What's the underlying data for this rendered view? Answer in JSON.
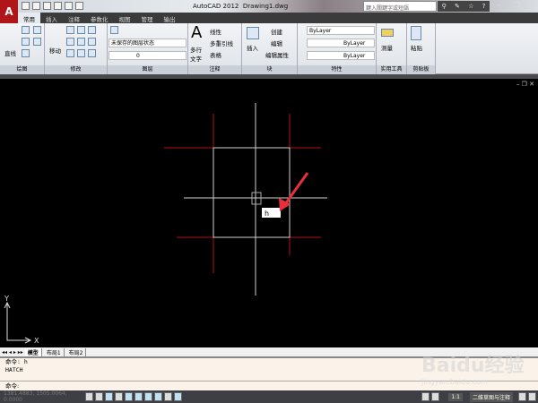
{
  "app": {
    "title": "AutoCAD 2012",
    "document": "Drawing1.dwg",
    "logo": "A",
    "search_placeholder": "鍵入關鍵字或短語",
    "tool_icons": [
      "binoculars-icon",
      "wrench-icon",
      "star-icon",
      "help-icon"
    ]
  },
  "tabs": [
    "常用",
    "插入",
    "注释",
    "参数化",
    "视图",
    "管理",
    "输出"
  ],
  "ribbon": {
    "draw": {
      "line": "直线",
      "label": "绘图"
    },
    "modify": {
      "move": "移动",
      "label": "修改"
    },
    "layers": {
      "state": "未保存的图层状态",
      "layer": "0",
      "label": "图层"
    },
    "annotation": {
      "text": "多行文字",
      "linear": "线性",
      "mleader": "多重引线",
      "table": "表格",
      "label": "注释"
    },
    "block": {
      "insert": "插入",
      "create": "创建",
      "edit": "编辑",
      "attr": "编辑属性",
      "label": "块"
    },
    "properties": {
      "color": "ByLayer",
      "linetype": "ByLayer",
      "lineweight": "ByLayer",
      "label": "特性"
    },
    "utilities": {
      "measure": "测量",
      "label": "实用工具"
    },
    "clipboard": {
      "paste": "粘贴",
      "label": "剪贴板"
    }
  },
  "layout_tabs": [
    "模型",
    "布局1",
    "布局2"
  ],
  "command": {
    "history": [
      "命令: h",
      "HATCH"
    ],
    "prompt": "命令:"
  },
  "canvas": {
    "input_tooltip": "h",
    "ucs_x": "X",
    "ucs_y": "Y",
    "colors": {
      "background": "#000000",
      "grid": "#d0d0d0",
      "red": "#b01010",
      "arrow": "#e8303a"
    }
  },
  "status": {
    "coords": "1381.4883, 1505.0064, 0.0000",
    "annotation_scale": "1:1",
    "workspace": "二维草图与注释"
  },
  "watermark": {
    "text": "Baidu经验",
    "url": "jingyan.baidu.com"
  }
}
